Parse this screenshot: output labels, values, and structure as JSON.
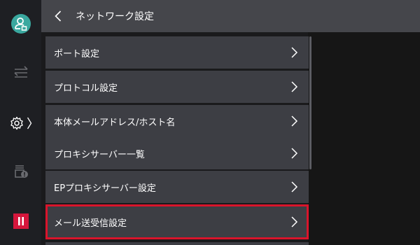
{
  "header": {
    "title": "ネットワーク設定",
    "back_icon": "chevron-left-icon"
  },
  "sidebar": {
    "items": [
      {
        "name": "account",
        "icon": "user-account-icon"
      },
      {
        "name": "transfer",
        "icon": "transfer-arrows-icon"
      },
      {
        "name": "settings",
        "icon": "gear-icon",
        "indicator": "〉"
      },
      {
        "name": "device",
        "icon": "device-status-icon"
      },
      {
        "name": "pause",
        "icon": "pause-icon"
      }
    ]
  },
  "menu": {
    "items": [
      {
        "label": "ポート設定"
      },
      {
        "label": "プロトコル設定"
      },
      {
        "label": "本体メールアドレス/ホスト名"
      },
      {
        "label": "プロキシサーバー一覧"
      },
      {
        "label": "EPプロキシサーバー設定"
      },
      {
        "label": "メール送受信設定",
        "highlighted": true
      }
    ]
  },
  "colors": {
    "accent_avatar": "#3aa89f",
    "highlight_border": "#d9142b",
    "pause_button": "#d6163c"
  }
}
